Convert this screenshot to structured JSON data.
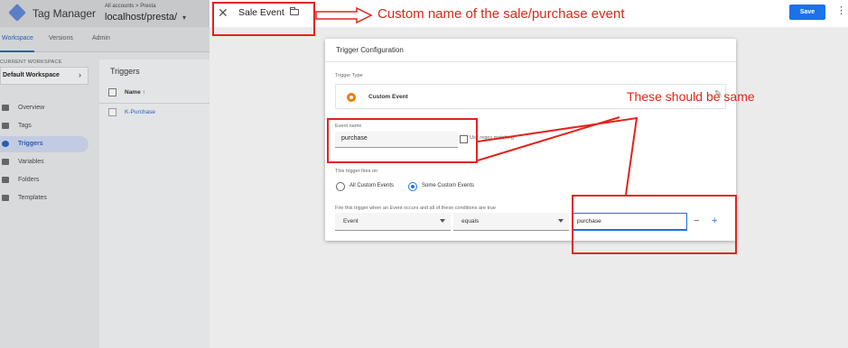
{
  "app": {
    "title": "Tag Manager",
    "account_crumb": "All accounts > Presta",
    "container_name": "localhost/presta/",
    "tabs": [
      "Workspace",
      "Versions",
      "Admin"
    ]
  },
  "sidebar": {
    "current_workspace_label": "CURRENT WORKSPACE",
    "workspace_name": "Default Workspace",
    "items": [
      {
        "label": "Overview",
        "icon": "overview-icon"
      },
      {
        "label": "Tags",
        "icon": "tag-icon"
      },
      {
        "label": "Triggers",
        "icon": "trigger-icon",
        "active": true
      },
      {
        "label": "Variables",
        "icon": "variables-icon"
      },
      {
        "label": "Folders",
        "icon": "folder-icon"
      },
      {
        "label": "Templates",
        "icon": "template-icon"
      }
    ]
  },
  "triggers_list": {
    "heading": "Triggers",
    "column_name": "Name ↑",
    "rows": [
      "K-Purchase"
    ]
  },
  "editor": {
    "event_title": "Sale Event",
    "save_label": "Save",
    "close_glyph": "✕",
    "more_glyph": "⋮"
  },
  "trigger_config": {
    "title": "Trigger Configuration",
    "trigger_type_label": "Trigger Type",
    "trigger_type_name": "Custom Event",
    "edit_glyph": "✎",
    "event_name_label": "Event name",
    "event_name_value": "purchase",
    "regex_label": "Use regex matching",
    "fires_on_label": "This trigger fires on",
    "fires_on_options": [
      {
        "label": "All Custom Events",
        "selected": false
      },
      {
        "label": "Some Custom Events",
        "selected": true
      }
    ],
    "condition_label": "Fire this trigger when an Event occurs and all of these conditions are true",
    "condition": {
      "variable": "Event",
      "operator": "equals",
      "value": "purchase"
    },
    "remove_glyph": "−",
    "add_glyph": "+"
  },
  "annotations": {
    "event_name_note": "Custom name of the sale/purchase event",
    "same_note": "These should be same",
    "color": "#e3231b"
  },
  "colors": {
    "primary_blue": "#1a73e8",
    "custom_event_orange": "#f57c00",
    "annotation_red": "#e3231b"
  }
}
